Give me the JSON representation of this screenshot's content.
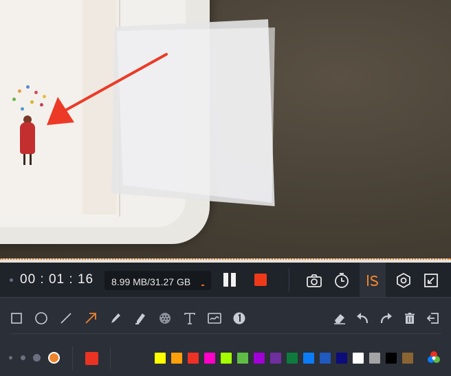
{
  "recording": {
    "elapsed_time": "00 : 01 : 16",
    "file_size": "8.99 MB/31.27 GB"
  },
  "recbar_tools": [
    {
      "name": "screenshot-camera-icon"
    },
    {
      "name": "timer-clock-icon"
    },
    {
      "name": "annotation-toggle-icon"
    },
    {
      "name": "settings-hexagon-icon"
    },
    {
      "name": "minimize-window-icon"
    }
  ],
  "annotation_tools": [
    {
      "name": "rectangle-tool-icon"
    },
    {
      "name": "ellipse-tool-icon"
    },
    {
      "name": "line-tool-icon"
    },
    {
      "name": "arrow-tool-icon"
    },
    {
      "name": "pen-tool-icon"
    },
    {
      "name": "highlighter-tool-icon"
    },
    {
      "name": "mosaic-blur-tool-icon"
    },
    {
      "name": "text-tool-icon"
    },
    {
      "name": "image-sticker-tool-icon"
    },
    {
      "name": "step-number-tool-icon"
    }
  ],
  "edit_actions": [
    {
      "name": "eraser-icon"
    },
    {
      "name": "undo-icon"
    },
    {
      "name": "redo-icon"
    },
    {
      "name": "clear-trash-icon"
    },
    {
      "name": "exit-annotation-icon"
    }
  ],
  "brush_sizes": [
    {
      "name": "brush-size-1"
    },
    {
      "name": "brush-size-2"
    },
    {
      "name": "brush-size-3"
    },
    {
      "name": "brush-size-4",
      "selected": true
    }
  ],
  "colors": {
    "accent": "#f0842a",
    "current": "#ea3323",
    "active_tool": "#f0842a",
    "stop": "#ef3a1a",
    "palette": [
      "#ffff00",
      "#ff9f0a",
      "#ee3124",
      "#ff00c8",
      "#a4ff00",
      "#5fbd46",
      "#a100d6",
      "#6f2f9e",
      "#0e7b3d",
      "#0b7cf5",
      "#2059c0",
      "#0c0c7a",
      "#ffffff",
      "#a4a4a4",
      "#000000",
      "#8a6432"
    ]
  }
}
